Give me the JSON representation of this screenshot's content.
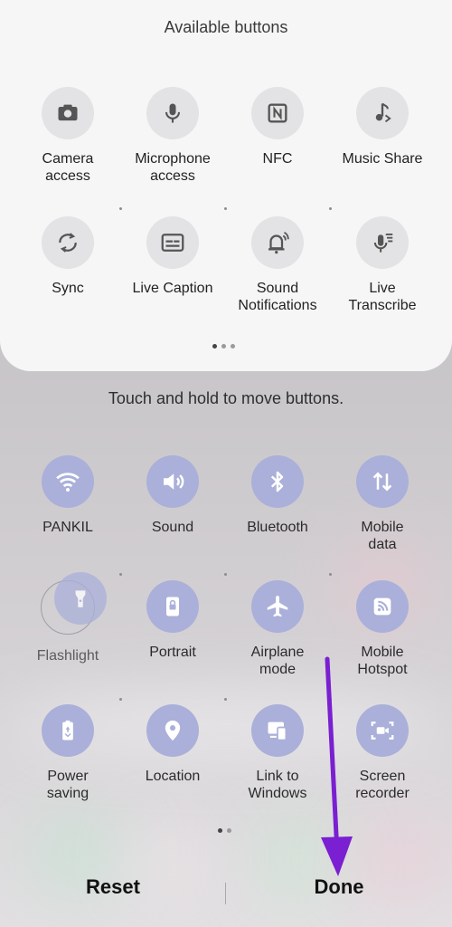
{
  "available": {
    "title": "Available buttons",
    "items": [
      {
        "label": "Camera\naccess",
        "icon": "camera-icon"
      },
      {
        "label": "Microphone\naccess",
        "icon": "microphone-icon"
      },
      {
        "label": "NFC",
        "icon": "nfc-icon"
      },
      {
        "label": "Music Share",
        "icon": "music-share-icon"
      },
      {
        "label": "Sync",
        "icon": "sync-icon"
      },
      {
        "label": "Live Caption",
        "icon": "live-caption-icon"
      },
      {
        "label": "Sound\nNotifications",
        "icon": "sound-notifications-icon"
      },
      {
        "label": "Live\nTranscribe",
        "icon": "live-transcribe-icon"
      }
    ]
  },
  "hint": "Touch and hold to move buttons.",
  "quick": {
    "items": [
      {
        "label": "PANKIL",
        "icon": "wifi-icon"
      },
      {
        "label": "Sound",
        "icon": "sound-icon"
      },
      {
        "label": "Bluetooth",
        "icon": "bluetooth-icon"
      },
      {
        "label": "Mobile\ndata",
        "icon": "mobile-data-icon"
      },
      {
        "label": "Flashlight",
        "icon": "flashlight-icon"
      },
      {
        "label": "Portrait",
        "icon": "portrait-icon"
      },
      {
        "label": "Airplane\nmode",
        "icon": "airplane-icon"
      },
      {
        "label": "Mobile\nHotspot",
        "icon": "hotspot-icon"
      },
      {
        "label": "Power\nsaving",
        "icon": "power-saving-icon"
      },
      {
        "label": "Location",
        "icon": "location-icon"
      },
      {
        "label": "Link to\nWindows",
        "icon": "link-to-windows-icon"
      },
      {
        "label": "Screen\nrecorder",
        "icon": "screen-recorder-icon"
      }
    ]
  },
  "bottom": {
    "reset": "Reset",
    "done": "Done"
  },
  "colors": {
    "accent": "#aab0d9",
    "arrow": "#7a1fd1"
  }
}
